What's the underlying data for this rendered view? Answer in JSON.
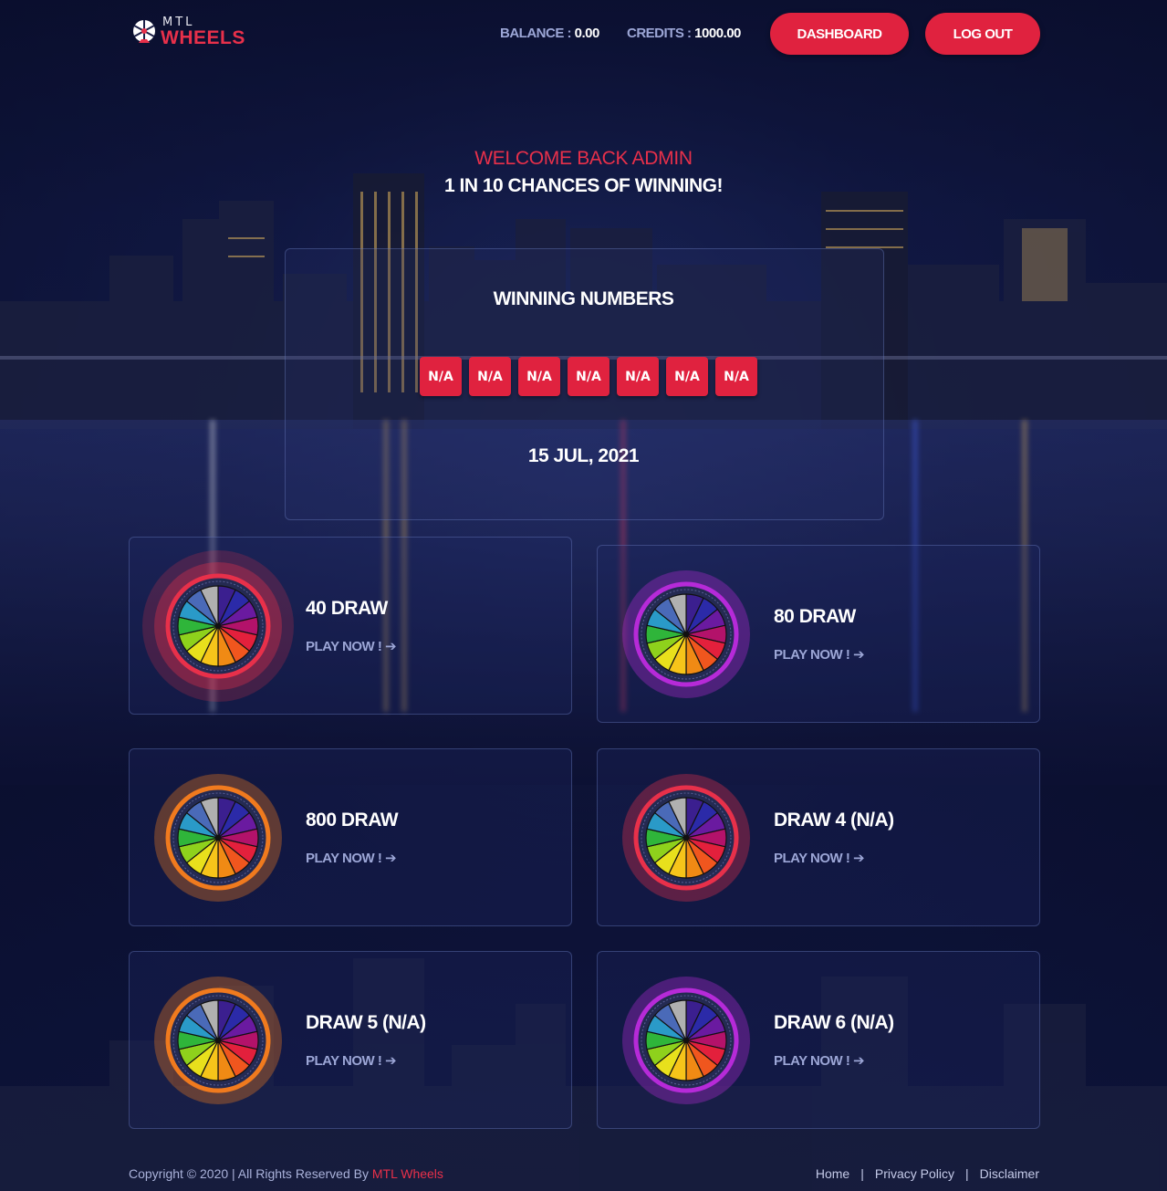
{
  "header": {
    "logo_small": "MTL",
    "logo_big": "WHEELS",
    "balance_label": "BALANCE :",
    "balance_value": "0.00",
    "credits_label": "CREDITS :",
    "credits_value": "1000.00",
    "dashboard_label": "DASHBOARD",
    "logout_label": "LOG OUT"
  },
  "hero": {
    "welcome": "WELCOME BACK ADMIN",
    "chances": "1 IN 10 CHANCES OF WINNING!"
  },
  "winning": {
    "title": "WINNING NUMBERS",
    "numbers": [
      "N/A",
      "N/A",
      "N/A",
      "N/A",
      "N/A",
      "N/A",
      "N/A"
    ],
    "date": "15 JUL, 2021"
  },
  "draws": [
    {
      "name": "40 DRAW",
      "play": "PLAY NOW ! ➔",
      "ring_color": "#e8304a"
    },
    {
      "name": "80 DRAW",
      "play": "PLAY NOW ! ➔",
      "ring_color": "#b62ad8"
    },
    {
      "name": "800 DRAW",
      "play": "PLAY NOW ! ➔",
      "ring_color": "#f07a1e"
    },
    {
      "name": "DRAW 4 (N/A)",
      "play": "PLAY NOW ! ➔",
      "ring_color": "#e8304a"
    },
    {
      "name": "DRAW 5 (N/A)",
      "play": "PLAY NOW ! ➔",
      "ring_color": "#f07a1e"
    },
    {
      "name": "DRAW 6 (N/A)",
      "play": "PLAY NOW ! ➔",
      "ring_color": "#b62ad8"
    }
  ],
  "footer": {
    "copyright": "Copyright © 2020 | All Rights Reserved By ",
    "brand": "MTL Wheels",
    "links": [
      "Home",
      "Privacy Policy",
      "Disclaimer"
    ]
  },
  "colors": {
    "accent": "#e0223f",
    "muted_text": "#9ca6d6"
  },
  "icons": {
    "logo": "wheel-logo-icon",
    "draw_wheel": "color-wheel-icon",
    "arrow": "arrow-right-icon"
  }
}
